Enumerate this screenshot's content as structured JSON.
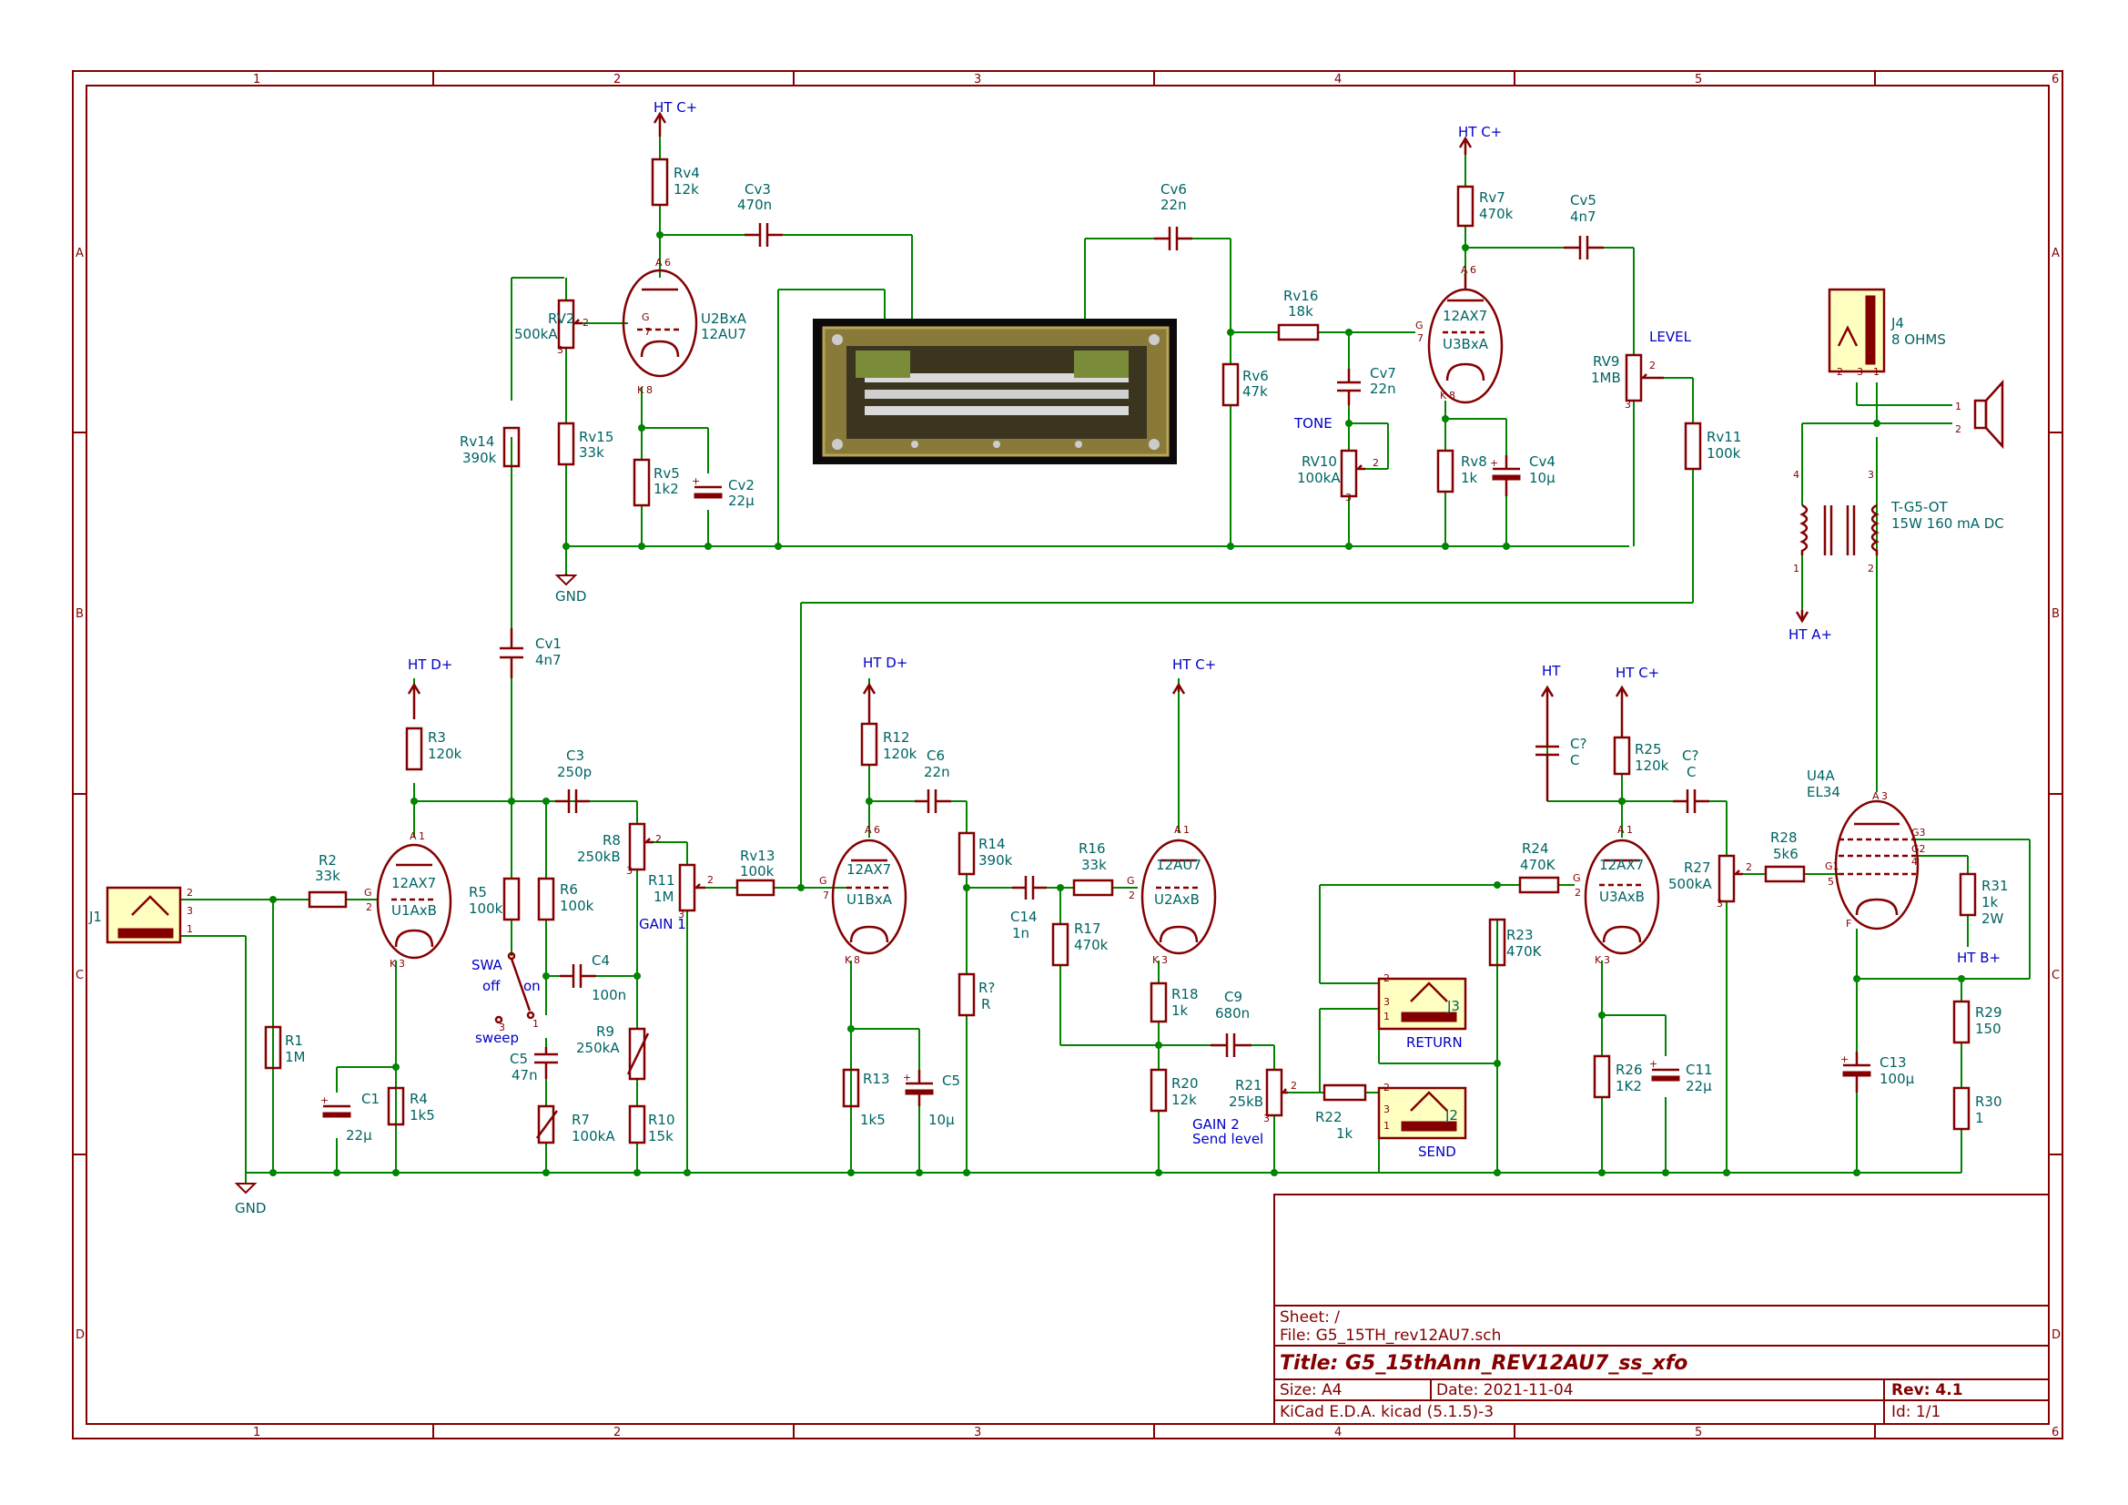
{
  "colors": {
    "frame": "#840000",
    "wire": "#008400",
    "ref": "#006464",
    "label": "#0000c4",
    "symbol_fill": "#ffffc2"
  },
  "grid": {
    "cols": [
      "1",
      "2",
      "3",
      "4",
      "5",
      "6"
    ],
    "rows": [
      "A",
      "B",
      "C",
      "D"
    ]
  },
  "title_block": {
    "sheet": "Sheet: /",
    "file": "File: G5_15TH_rev12AU7.sch",
    "title": "Title: G5_15thAnn_REV12AU7_ss_xfo",
    "size": "Size: A4",
    "date": "Date: 2021-11-04",
    "rev": "Rev: 4.1",
    "tool": "KiCad E.D.A.  kicad (5.1.5)-3",
    "id": "Id: 1/1"
  },
  "power": {
    "htc1": "HT C+",
    "htc2": "HT C+",
    "htd1": "HT D+",
    "htd2": "HT D+",
    "htc3": "HT C+",
    "ht": "HT",
    "htc4": "HT C+",
    "hta": "HT A+",
    "htb": "HT B+",
    "gnd1": "GND",
    "gnd2": "GND"
  },
  "labels": {
    "gain1": "GAIN 1",
    "gain2": "GAIN 2",
    "sendlevel": "Send level",
    "tone": "TONE",
    "level": "LEVEL",
    "return": "RETURN",
    "send": "SEND",
    "swa": "SWA",
    "off": "off",
    "on": "on",
    "sweep": "sweep"
  },
  "components": {
    "rv4": [
      "Rv4",
      "12k"
    ],
    "cv3": [
      "Cv3",
      "470n"
    ],
    "u2b": [
      "U2BxA",
      "12AU7"
    ],
    "rv2": [
      "RV2",
      "500kA"
    ],
    "rv15": [
      "Rv15",
      "33k"
    ],
    "rv5": [
      "Rv5",
      "1k2"
    ],
    "cv2": [
      "Cv2",
      "22µ"
    ],
    "rv14": [
      "Rv14",
      "390k"
    ],
    "cv6": [
      "Cv6",
      "22n"
    ],
    "rv16": [
      "Rv16",
      "18k"
    ],
    "rv6": [
      "Rv6",
      "47k"
    ],
    "cv7": [
      "Cv7",
      "22n"
    ],
    "rv10": [
      "RV10",
      "100kA"
    ],
    "rv7": [
      "Rv7",
      "470k"
    ],
    "u3b": [
      "12AX7",
      "U3BxA"
    ],
    "rv8": [
      "Rv8",
      "1k"
    ],
    "cv4": [
      "Cv4",
      "10µ"
    ],
    "cv5": [
      "Cv5",
      "4n7"
    ],
    "rv9": [
      "RV9",
      "1MB"
    ],
    "rv11": [
      "Rv11",
      "100k"
    ],
    "j4": [
      "J4",
      "8 OHMS"
    ],
    "tr": [
      "T-G5-OT",
      "15W 160 mA DC"
    ],
    "cv1": [
      "Cv1",
      "4n7"
    ],
    "r3": [
      "R3",
      "120k"
    ],
    "c3": [
      "C3",
      "250p"
    ],
    "r2": [
      "R2",
      "33k"
    ],
    "u1a": [
      "12AX7",
      "U1AxB"
    ],
    "r8": [
      "R8",
      "250kB"
    ],
    "r11": [
      "R11",
      "1M"
    ],
    "rv13": [
      "Rv13",
      "100k"
    ],
    "r5": [
      "R5",
      "100k"
    ],
    "r6": [
      "R6",
      "100k"
    ],
    "c4": [
      "C4",
      "100n"
    ],
    "c5": [
      "C5",
      "47n"
    ],
    "r9": [
      "R9",
      "250kA"
    ],
    "r7": [
      "R7",
      "100kA"
    ],
    "r10": [
      "R10",
      "15k"
    ],
    "r1": [
      "R1",
      "1M"
    ],
    "c1": [
      "C1",
      "22µ"
    ],
    "r4": [
      "R4",
      "1k5"
    ],
    "r12": [
      "R12",
      "120k"
    ],
    "c6": [
      "C6",
      "22n"
    ],
    "u1b": [
      "12AX7",
      "U1BxA"
    ],
    "r14": [
      "R14",
      "390k"
    ],
    "c14": [
      "C14",
      "1n"
    ],
    "r16": [
      "R16",
      "33k"
    ],
    "u2a": [
      "12AU7",
      "U2AxB"
    ],
    "r17": [
      "R17",
      "470k"
    ],
    "rq": [
      "R?",
      "R"
    ],
    "r13": [
      "R13",
      "1k5"
    ],
    "c5b": [
      "C5",
      "10µ"
    ],
    "r18": [
      "R18",
      "1k"
    ],
    "c9": [
      "C9",
      "680n"
    ],
    "r20": [
      "R20",
      "12k"
    ],
    "r21": [
      "R21",
      "25kB"
    ],
    "r22": [
      "R22",
      "1k"
    ],
    "r24": [
      "R24",
      "470K"
    ],
    "r23": [
      "R23",
      "470K"
    ],
    "cq1": [
      "C?",
      "C"
    ],
    "r25": [
      "R25",
      "120k"
    ],
    "cq2": [
      "C?",
      "C"
    ],
    "u3a": [
      "12AX7",
      "U3AxB"
    ],
    "r27": [
      "R27",
      "500kA"
    ],
    "r28": [
      "R28",
      "5k6"
    ],
    "u4a": [
      "U4A",
      "EL34"
    ],
    "r31": [
      "R31",
      "1k",
      "2W"
    ],
    "r26": [
      "R26",
      "1K2"
    ],
    "c11": [
      "C11",
      "22µ"
    ],
    "c13": [
      "C13",
      "100µ"
    ],
    "r29": [
      "R29",
      "150"
    ],
    "r30": [
      "R30",
      "1"
    ],
    "j1": "J1",
    "j2": "J2",
    "j3": "J3"
  },
  "pins": {
    "g": "G",
    "a": "A",
    "k": "K",
    "f": "F",
    "g1": "G1",
    "g2": "G2",
    "g3": "G3",
    "n1": "1",
    "n2": "2",
    "n3": "3",
    "n4": "4",
    "n5": "5",
    "n6": "6",
    "n7": "7",
    "n8": "8"
  },
  "icons": [
    "spring-reverb-photo",
    "speaker-icon",
    "ground-icon",
    "power-arrow-icon",
    "jack-icon",
    "tube-icon",
    "transformer-icon"
  ]
}
